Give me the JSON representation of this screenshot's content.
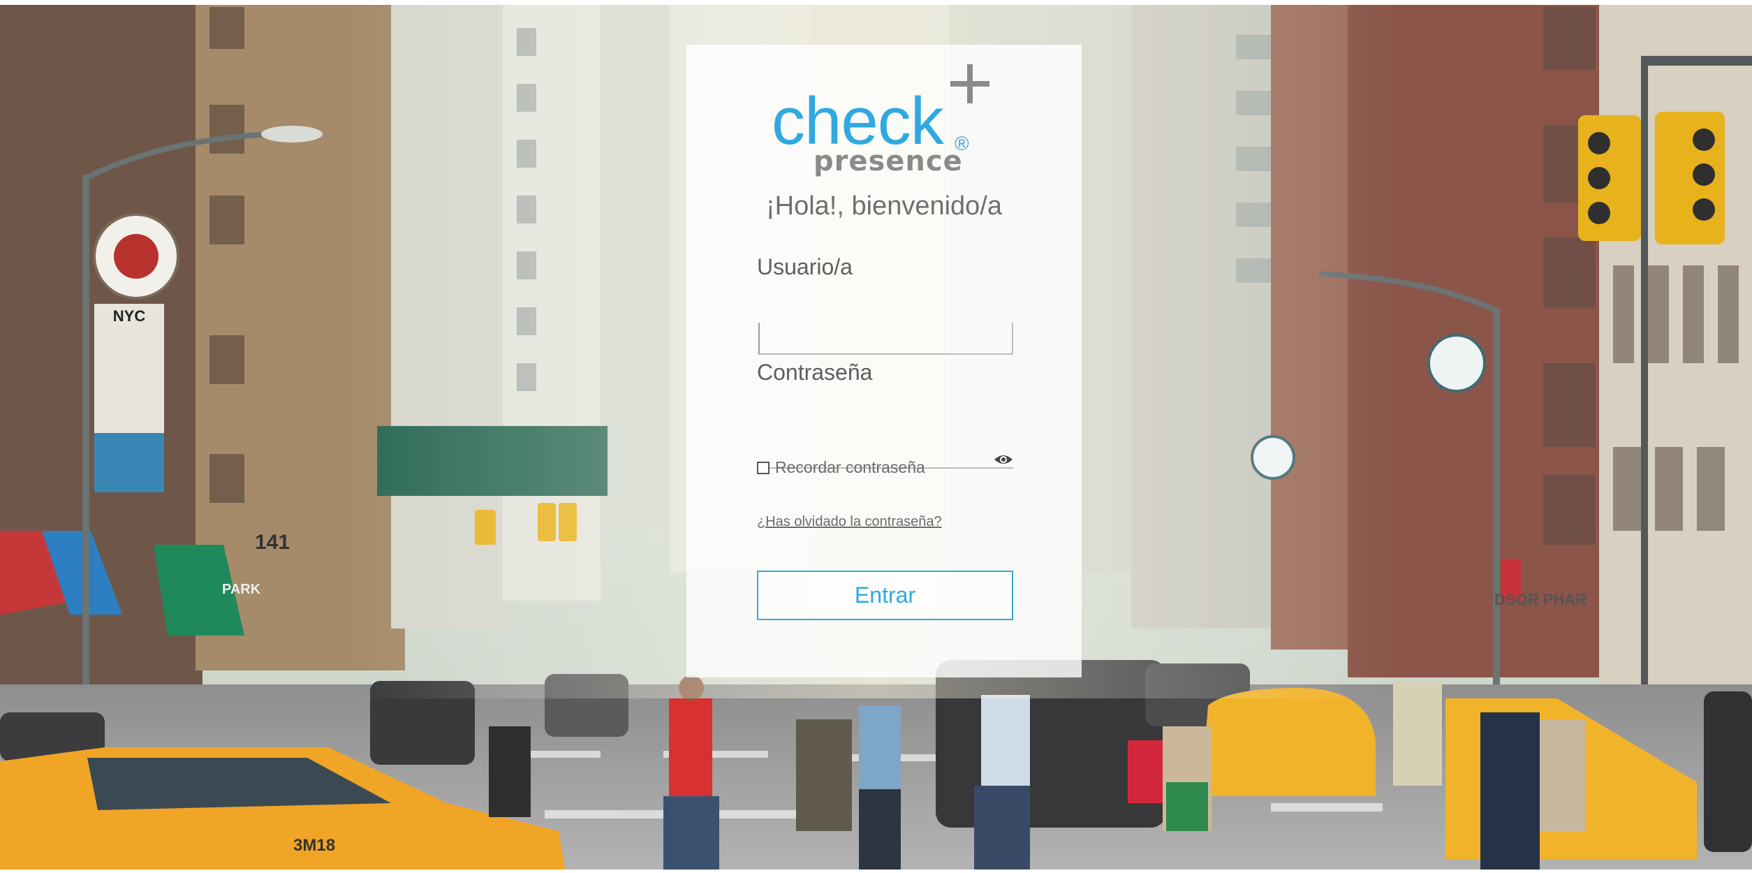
{
  "logo": {
    "word": "check",
    "registered": "®",
    "sub": "presence"
  },
  "greeting": "¡Hola!, bienvenido/a",
  "form": {
    "user_label": "Usuario/a",
    "user_value": "",
    "password_label": "Contraseña",
    "password_value": "",
    "remember_label": "Recordar contraseña",
    "remember_checked": false,
    "forgot_link": "¿Has olvidado la contraseña?",
    "submit_label": "Entrar"
  },
  "colors": {
    "accent": "#2fa9e0",
    "logo_gray": "#8a8a8a",
    "text": "#6f6f6f"
  },
  "icons": {
    "password_toggle": "eye-icon",
    "logo_mark": "plus-icon"
  },
  "background": {
    "sign_nyc": "NYC",
    "street_number": "141",
    "shop_sign": "PARK",
    "pharmacy_sign": "DSOR PHAR",
    "taxi_number": "3M18"
  }
}
